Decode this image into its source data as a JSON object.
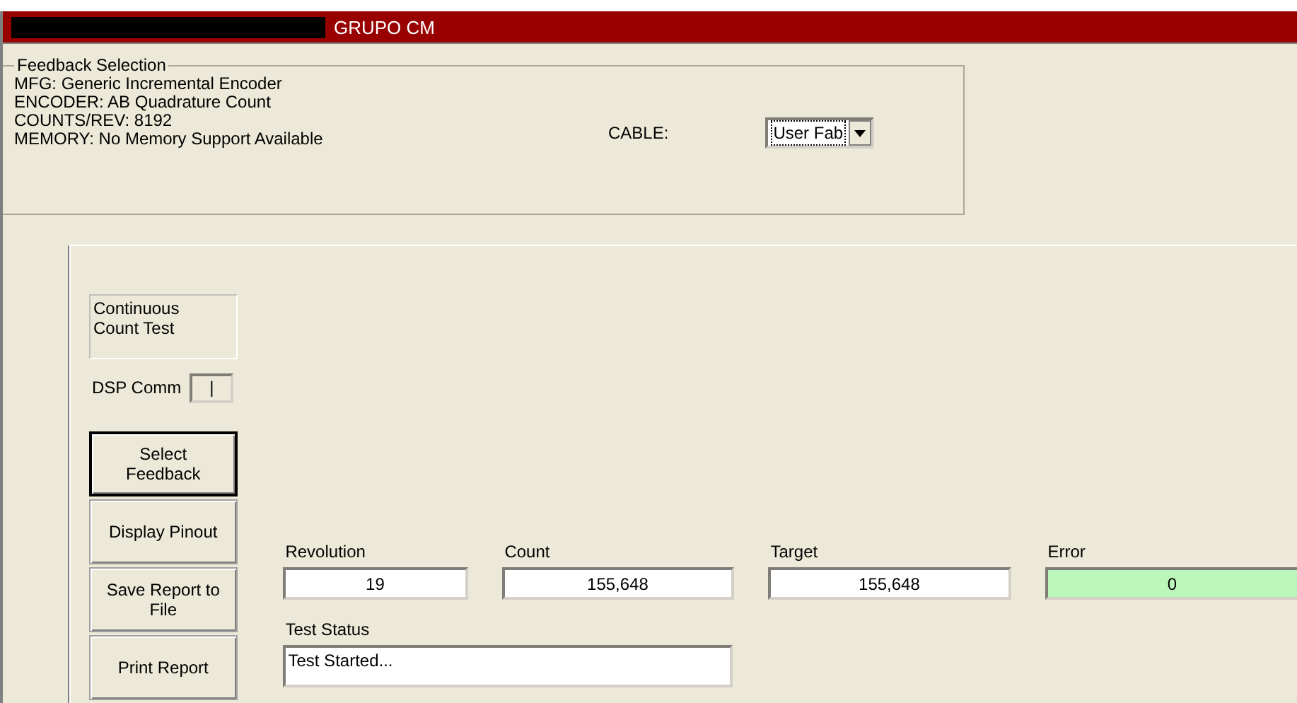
{
  "window": {
    "title": "GRUPO CM"
  },
  "feedback_selection": {
    "title": "Feedback Selection",
    "lines": [
      "MFG: Generic Incremental Encoder",
      "ENCODER: AB Quadrature Count",
      "COUNTS/REV: 8192",
      "MEMORY: No Memory Support Available"
    ],
    "cable_label": "CABLE:",
    "cable_value": "User Fab"
  },
  "test_name": "Continuous Count Test",
  "dsp_comm": {
    "label": "DSP Comm",
    "value": "|"
  },
  "buttons": [
    {
      "label": "Select Feedback",
      "default": true
    },
    {
      "label": "Display Pinout",
      "default": false
    },
    {
      "label": "Save Report to File",
      "default": false
    },
    {
      "label": "Print Report",
      "default": false
    }
  ],
  "readouts": [
    {
      "label": "Revolution",
      "value": "19",
      "color": "#ffffff"
    },
    {
      "label": "Count",
      "value": "155,648",
      "color": "#ffffff"
    },
    {
      "label": "Target",
      "value": "155,648",
      "color": "#ffffff"
    },
    {
      "label": "Error",
      "value": "0",
      "color": "#bbf7bb"
    }
  ],
  "test_status": {
    "label": "Test Status",
    "value": "Test Started..."
  }
}
